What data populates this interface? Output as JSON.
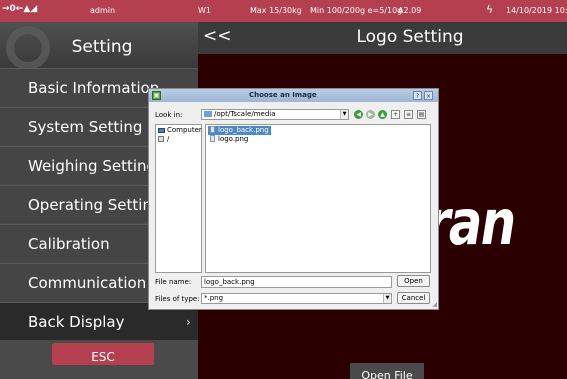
{
  "status_bar": {
    "left_indicators": "→0←▲◢",
    "user": "admin",
    "channel": "W1",
    "max": "Max 15/30kg",
    "min_e": "Min 100/200g e=5/10g",
    "version": "A2.09",
    "lightning_icon": "lightning-icon",
    "datetime": "14/10/2019 10:"
  },
  "sidebar": {
    "title": "Setting",
    "items": [
      {
        "label": "Basic Information",
        "chevron": ""
      },
      {
        "label": "System Setting",
        "chevron": ""
      },
      {
        "label": "Weighing Setting",
        "chevron": ""
      },
      {
        "label": "Operating Setting",
        "chevron": ""
      },
      {
        "label": "Calibration",
        "chevron": ""
      },
      {
        "label": "Communication",
        "chevron": ""
      },
      {
        "label": "Back Display",
        "chevron": "›"
      }
    ],
    "esc_label": "ESC"
  },
  "main": {
    "back_label": "<<",
    "title": "Logo Setting",
    "preview_text": "ran",
    "open_file_label": "Open File"
  },
  "dialog": {
    "title": "Choose an Image",
    "help_label": "?",
    "close_label": "×",
    "look_in_label": "Look in:",
    "look_in_value": "/opt/Tscale/media",
    "side_entries": [
      "Computer",
      "/"
    ],
    "files": [
      {
        "name": "logo_back.png",
        "selected": true
      },
      {
        "name": "logo.png",
        "selected": false
      }
    ],
    "file_name_label": "File name:",
    "file_name_value": "logo_back.png",
    "file_types_label": "Files of type:",
    "file_types_value": "*.png",
    "open_label": "Open",
    "cancel_label": "Cancel"
  },
  "colors": {
    "accent": "#b4404f",
    "sidebar_bg": "#454545",
    "preview_bg": "#2b0000",
    "selection": "#4f88c8"
  }
}
